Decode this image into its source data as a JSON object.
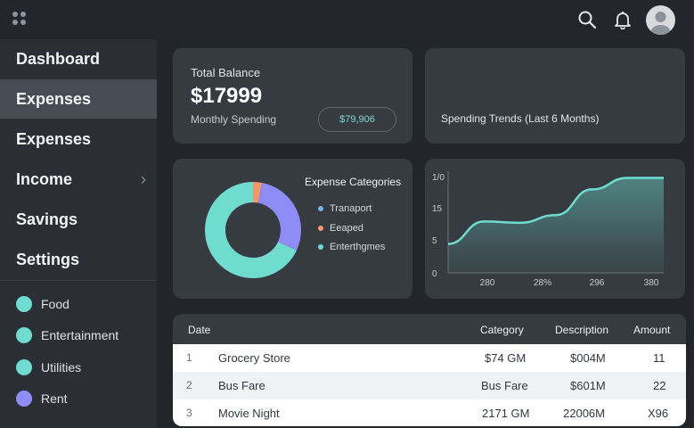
{
  "topbar": {
    "icons": [
      "apps-icon",
      "search-icon",
      "bell-icon",
      "avatar"
    ]
  },
  "sidebar": {
    "nav": [
      {
        "label": "Dashboard",
        "active": false
      },
      {
        "label": "Expenses",
        "active": true
      },
      {
        "label": "Expenses",
        "active": false
      },
      {
        "label": "Income",
        "active": false,
        "chevron": "›"
      },
      {
        "label": "Savings",
        "active": false
      },
      {
        "label": "Settings",
        "active": false
      }
    ],
    "legend": [
      {
        "label": "Food",
        "color": "#6fdccf"
      },
      {
        "label": "Entertainment",
        "color": "#6fdccf"
      },
      {
        "label": "Utilities",
        "color": "#6fdccf"
      },
      {
        "label": "Rent",
        "color": "#8e8df5"
      }
    ]
  },
  "balance": {
    "label": "Total Balance",
    "value": "$17999",
    "monthly_label": "Monthly Spending",
    "monthly_value": "$79,906"
  },
  "trends": {
    "title": "Spending Trends (Last 6 Months)"
  },
  "categories": {
    "title": "Expense Categories",
    "legend": [
      {
        "label": "Tranaport",
        "color": "#79b6e6"
      },
      {
        "label": "Eeaped",
        "color": "#f0996b"
      },
      {
        "label": "Enterthgmes",
        "color": "#6fdccf"
      }
    ],
    "slices": [
      {
        "value": 3,
        "color": "#f0996b"
      },
      {
        "value": 29,
        "color": "#8e8df5"
      },
      {
        "value": 68,
        "color": "#6fdccf"
      }
    ]
  },
  "chart_data": {
    "type": "area",
    "y_ticks": [
      "1/0",
      "15",
      "5",
      "0"
    ],
    "x_ticks": [
      "280",
      "28%",
      "296",
      "380"
    ],
    "color": "#6fdccf",
    "points": [
      [
        0,
        4.5
      ],
      [
        1,
        8.0
      ],
      [
        2,
        7.8
      ],
      [
        3,
        9.0
      ],
      [
        4,
        13.0
      ],
      [
        5,
        14.8
      ],
      [
        6,
        14.8
      ]
    ],
    "ylim": [
      0,
      15
    ]
  },
  "table": {
    "headers": [
      "Date",
      "Category",
      "Description",
      "Amount"
    ],
    "rows": [
      {
        "index": "1",
        "name": "Grocery Store",
        "category": "$74 GM",
        "description": "$004M",
        "amount": "11"
      },
      {
        "index": "2",
        "name": "Bus Fare",
        "category": "Bus Fare",
        "description": "$601M",
        "amount": "22"
      },
      {
        "index": "3",
        "name": "Movie Night",
        "category": "2171 GM",
        "description": "22006M",
        "amount": "X96"
      }
    ]
  }
}
